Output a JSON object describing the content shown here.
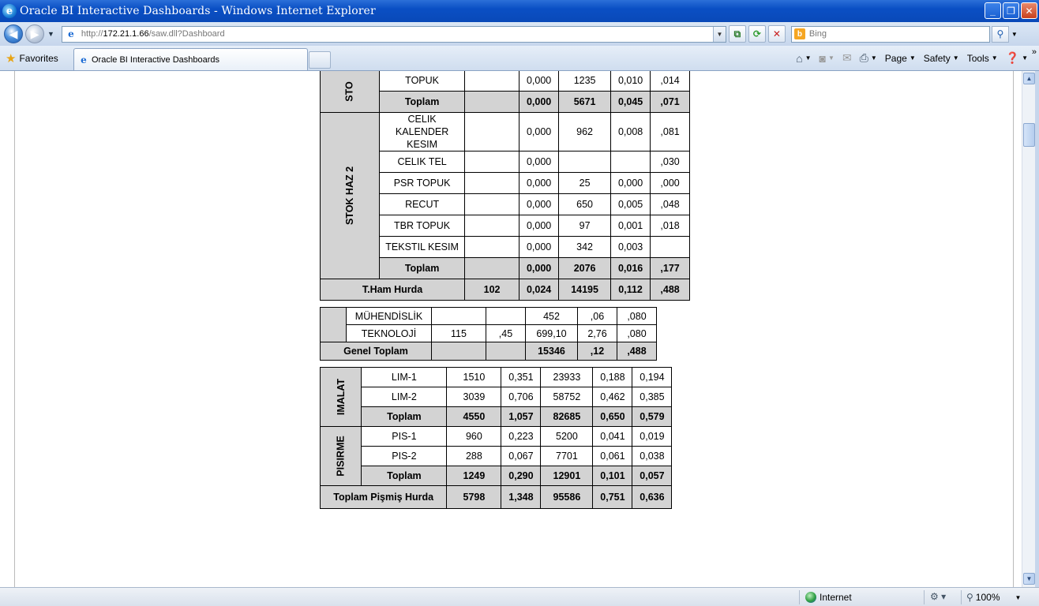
{
  "window": {
    "title": "Oracle BI Interactive Dashboards - Windows Internet Explorer",
    "minimize": "_",
    "maximize": "❐",
    "close": "✕"
  },
  "address": {
    "url_prefix": "http://",
    "url_host": "172.21.1.66",
    "url_path": "/saw.dll?Dashboard",
    "search_placeholder": "Bing"
  },
  "favorites": {
    "label": "Favorites"
  },
  "tab": {
    "label": "Oracle BI Interactive Dashboards"
  },
  "toolbar": {
    "page": "Page",
    "safety": "Safety",
    "tools": "Tools"
  },
  "table_top": {
    "rows": [
      {
        "group": "STO",
        "name": "TOPUK",
        "c2": "",
        "c3": "0,000",
        "c4": "1235",
        "c5": "0,010",
        "c6": ",014"
      },
      {
        "group": "STO",
        "name": "Toplam",
        "c2": "",
        "c3": "0,000",
        "c4": "5671",
        "c5": "0,045",
        "c6": ",071",
        "sum": true
      },
      {
        "group": "STOK HAZ 2",
        "name": "CELIK KALENDER KESIM",
        "c2": "",
        "c3": "0,000",
        "c4": "962",
        "c5": "0,008",
        "c6": ",081"
      },
      {
        "group": "STOK HAZ 2",
        "name": "CELIK TEL",
        "c2": "",
        "c3": "0,000",
        "c4": "",
        "c5": "",
        "c6": ",030"
      },
      {
        "group": "STOK HAZ 2",
        "name": "PSR TOPUK",
        "c2": "",
        "c3": "0,000",
        "c4": "25",
        "c5": "0,000",
        "c6": ",000"
      },
      {
        "group": "STOK HAZ 2",
        "name": "RECUT",
        "c2": "",
        "c3": "0,000",
        "c4": "650",
        "c5": "0,005",
        "c6": ",048"
      },
      {
        "group": "STOK HAZ 2",
        "name": "TBR TOPUK",
        "c2": "",
        "c3": "0,000",
        "c4": "97",
        "c5": "0,001",
        "c6": ",018"
      },
      {
        "group": "STOK HAZ 2",
        "name": "TEKSTIL KESIM",
        "c2": "",
        "c3": "0,000",
        "c4": "342",
        "c5": "0,003",
        "c6": ""
      },
      {
        "group": "STOK HAZ 2",
        "name": "Toplam",
        "c2": "",
        "c3": "0,000",
        "c4": "2076",
        "c5": "0,016",
        "c6": ",177",
        "sum": true
      }
    ],
    "total": {
      "name": "T.Ham Hurda",
      "c2": "102",
      "c3": "0,024",
      "c4": "14195",
      "c5": "0,112",
      "c6": ",488"
    }
  },
  "table_mid": {
    "rows": [
      {
        "name": "MÜHENDİSLİK",
        "c2": "",
        "c3": "",
        "c4": "452",
        "c5": ",06",
        "c6": ",080"
      },
      {
        "name": "TEKNOLOJİ",
        "c2": "115",
        "c3": ",45",
        "c4": "699,10",
        "c5": "2,76",
        "c6": ",080"
      }
    ],
    "total": {
      "name": "Genel Toplam",
      "c2": "",
      "c3": "",
      "c4": "15346",
      "c5": ",12",
      "c6": ",488"
    }
  },
  "table_bottom": {
    "groups": [
      {
        "label": "IMALAT",
        "rows": [
          {
            "name": "LIM-1",
            "c2": "1510",
            "c3": "0,351",
            "c4": "23933",
            "c5": "0,188",
            "c6": "0,194"
          },
          {
            "name": "LIM-2",
            "c2": "3039",
            "c3": "0,706",
            "c4": "58752",
            "c5": "0,462",
            "c6": "0,385"
          },
          {
            "name": "Toplam",
            "c2": "4550",
            "c3": "1,057",
            "c4": "82685",
            "c5": "0,650",
            "c6": "0,579",
            "sum": true
          }
        ]
      },
      {
        "label": "PISIRME",
        "rows": [
          {
            "name": "PIS-1",
            "c2": "960",
            "c3": "0,223",
            "c4": "5200",
            "c5": "0,041",
            "c6": "0,019"
          },
          {
            "name": "PIS-2",
            "c2": "288",
            "c3": "0,067",
            "c4": "7701",
            "c5": "0,061",
            "c6": "0,038"
          },
          {
            "name": "Toplam",
            "c2": "1249",
            "c3": "0,290",
            "c4": "12901",
            "c5": "0,101",
            "c6": "0,057",
            "sum": true
          }
        ]
      }
    ],
    "total": {
      "name": "Toplam Pişmiş Hurda",
      "c2": "5798",
      "c3": "1,348",
      "c4": "95586",
      "c5": "0,751",
      "c6": "0,636"
    }
  },
  "status": {
    "zone": "Internet",
    "zoom": "100%"
  }
}
